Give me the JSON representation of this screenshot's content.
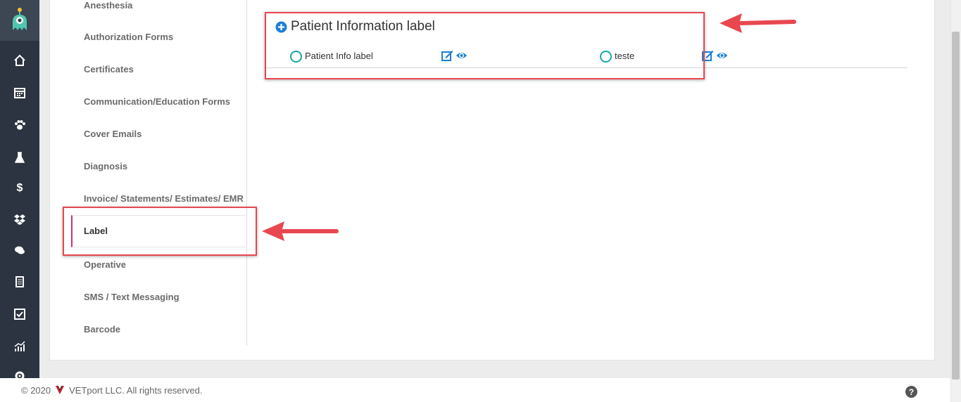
{
  "menu": {
    "items": [
      {
        "label": "Anesthesia"
      },
      {
        "label": "Authorization Forms"
      },
      {
        "label": "Certificates"
      },
      {
        "label": "Communication/Education Forms"
      },
      {
        "label": "Cover Emails"
      },
      {
        "label": "Diagnosis"
      },
      {
        "label": "Invoice/ Statements/ Estimates/ EMR"
      },
      {
        "label": "Label"
      },
      {
        "label": "Operative"
      },
      {
        "label": "SMS / Text Messaging"
      },
      {
        "label": "Barcode"
      }
    ],
    "active": "Label"
  },
  "section": {
    "title": "Patient Information label",
    "items": [
      {
        "label": "Patient Info label"
      },
      {
        "label": "teste"
      }
    ]
  },
  "sidebar_icons": [
    "home-icon",
    "calendar-icon",
    "paw-icon",
    "flask-icon",
    "dollar-icon",
    "dropbox-icon",
    "chat-icon",
    "document-icon",
    "checkbox-icon",
    "chart-icon",
    "gear-icon"
  ],
  "footer": {
    "copyright": "© 2020",
    "company": "VETport LLC. All rights reserved.",
    "help": "?"
  },
  "colors": {
    "accent": "#1b7fd6",
    "radio": "#1aa7a7",
    "active_border": "#d4306b",
    "annotation": "#e8474f",
    "rail": "#2b3440"
  }
}
